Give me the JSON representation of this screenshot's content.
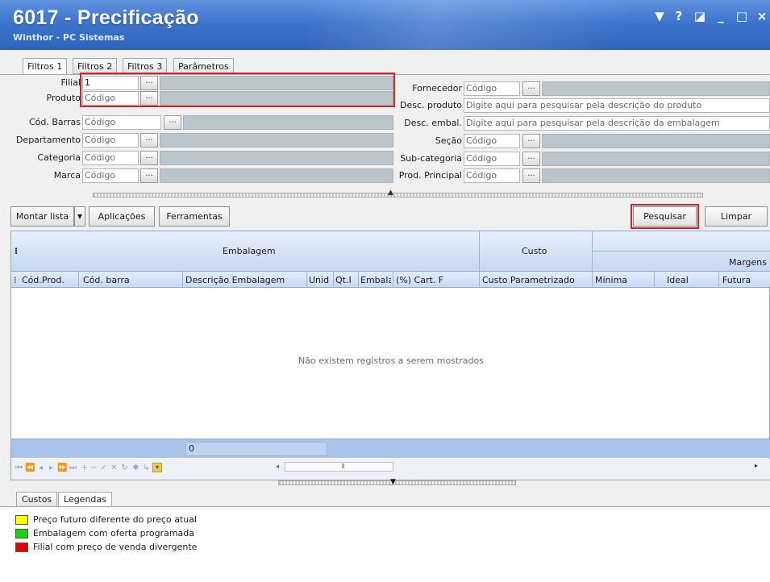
{
  "window": {
    "title": "6017 - Precificação",
    "subtitle": "Winthor - PC Sistemas",
    "controls": [
      "▼",
      "?",
      "◪",
      "_",
      "□",
      "×"
    ]
  },
  "tabs": [
    "Filtros 1",
    "Filtros 2",
    "Filtros 3",
    "Parâmetros"
  ],
  "filters": {
    "filial": {
      "label": "Filial",
      "value": "1"
    },
    "produto": {
      "label": "Produto",
      "placeholder": "Código"
    },
    "cod_barras": {
      "label": "Cód. Barras",
      "placeholder": "Código"
    },
    "departamento": {
      "label": "Departamento",
      "placeholder": "Código"
    },
    "categoria": {
      "label": "Categoria",
      "placeholder": "Código"
    },
    "marca": {
      "label": "Marca",
      "placeholder": "Código"
    },
    "fornecedor": {
      "label": "Fornecedor",
      "placeholder": "Código"
    },
    "desc_produto": {
      "label": "Desc. produto",
      "placeholder": "Digite aqui para pesquisar pela descrição do produto"
    },
    "desc_embal": {
      "label": "Desc. embal.",
      "placeholder": "Digite aqui para pesquisar pela descrição da embalagem"
    },
    "secao": {
      "label": "Seção",
      "placeholder": "Código"
    },
    "sub_categoria": {
      "label": "Sub-categoria",
      "placeholder": "Código"
    },
    "prod_principal": {
      "label": "Prod. Principal",
      "placeholder": "Código"
    },
    "ellipsis": "..."
  },
  "toolbar": {
    "montar_lista": "Montar lista",
    "aplicacoes": "Aplicações",
    "ferramentas": "Ferramentas",
    "pesquisar": "Pesquisar",
    "limpar": "Limpar"
  },
  "grid": {
    "band_embalagem": "Embalagem",
    "band_custo": "Custo",
    "band_margens": "Margens",
    "columns": [
      "Cód.Prod.",
      "Cód. barra",
      "Descrição Embalagem",
      "Unid",
      "Qt.I",
      "Embala",
      "(%) Cart. F",
      "Custo Parametrizado",
      "Mínima",
      "Ideal",
      "Futura"
    ],
    "empty_message": "Não existem registros a serem mostrados",
    "footer_value": "0"
  },
  "bottom_tabs": [
    "Custos",
    "Legendas"
  ],
  "legends": [
    {
      "text": "Preço futuro diferente do preço atual",
      "color": "#ffff00"
    },
    {
      "text": "Embalagem com oferta programada",
      "color": "#19d400"
    },
    {
      "text": "Filial com preço de venda divergente",
      "color": "#e00000"
    }
  ],
  "colors": {
    "titlebar": "#3d74cd",
    "highlight": "#d6232a",
    "grid_header": "#c6d7f1"
  }
}
